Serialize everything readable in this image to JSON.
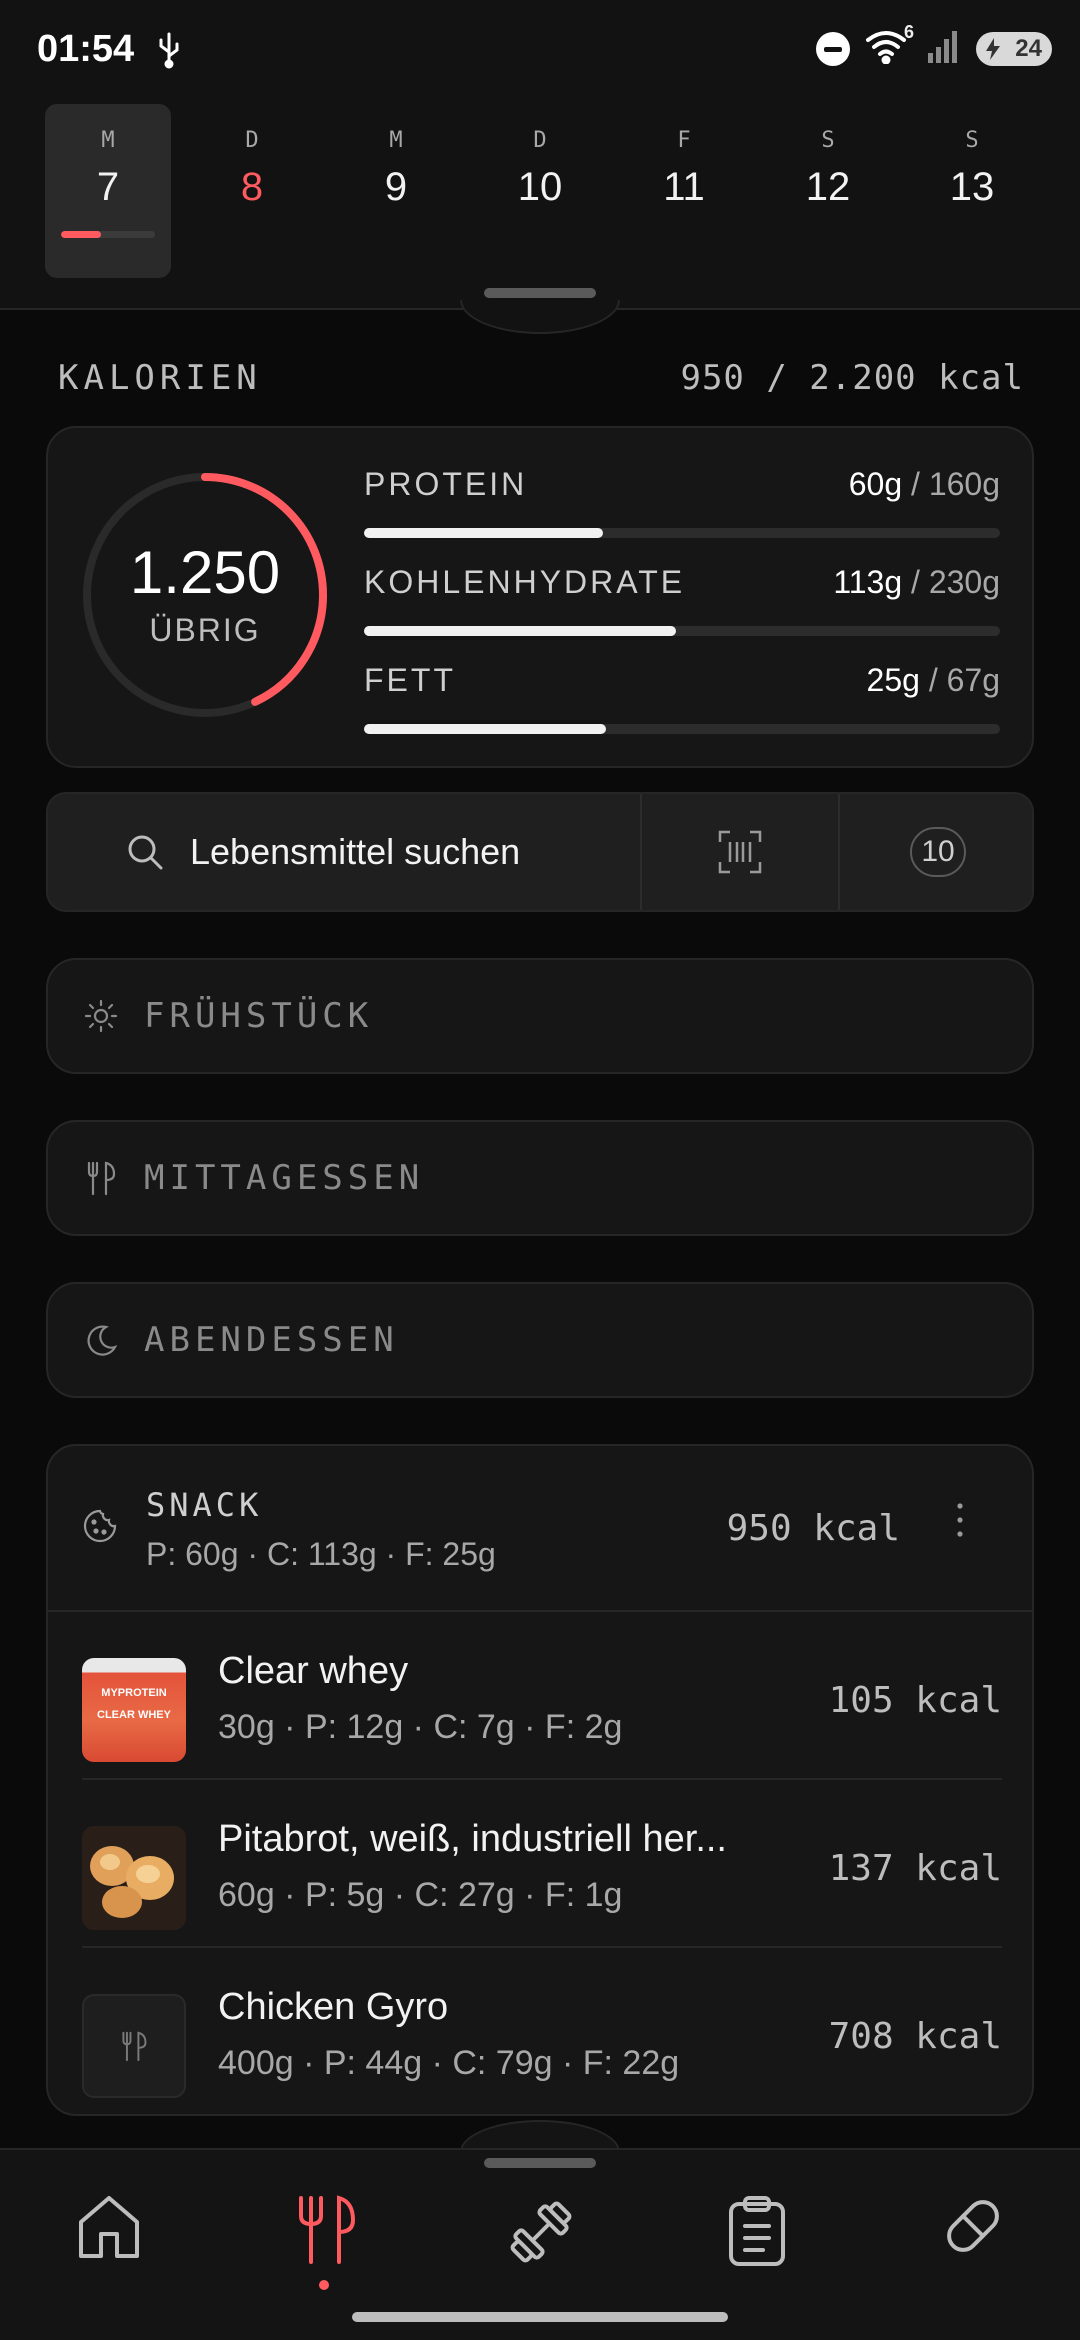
{
  "status_bar": {
    "time": "01:54",
    "wifi_badge": "6",
    "battery": "24",
    "icons": [
      "usb-icon",
      "do-not-disturb-icon",
      "wifi-icon",
      "signal-icon",
      "battery-charging-icon"
    ]
  },
  "week": {
    "days": [
      {
        "letter": "M",
        "num": "7",
        "active": true,
        "progress": 0.43
      },
      {
        "letter": "D",
        "num": "8",
        "today": true
      },
      {
        "letter": "M",
        "num": "9"
      },
      {
        "letter": "D",
        "num": "10"
      },
      {
        "letter": "F",
        "num": "11"
      },
      {
        "letter": "S",
        "num": "12"
      },
      {
        "letter": "S",
        "num": "13"
      }
    ]
  },
  "calories": {
    "label": "KALORIEN",
    "total": "950 / 2.200 kcal",
    "remaining": "1.250",
    "remaining_label": "ÜBRIG",
    "consumed_fraction": 0.43
  },
  "macros": [
    {
      "name": "PROTEIN",
      "value": "60g",
      "goal": "/ 160g",
      "fraction": 0.375
    },
    {
      "name": "KOHLENHYDRATE",
      "value": "113g",
      "goal": "/ 230g",
      "fraction": 0.49
    },
    {
      "name": "FETT",
      "value": "25g",
      "goal": "/ 67g",
      "fraction": 0.38
    }
  ],
  "search": {
    "label": "Lebensmittel suchen",
    "quick_count": "10"
  },
  "meals": {
    "breakfast": "FRÜHSTÜCK",
    "lunch": "MITTAGESSEN",
    "dinner": "ABENDESSEN"
  },
  "snack": {
    "title": "SNACK",
    "macros": "P: 60g · C: 113g · F: 25g",
    "kcal": "950 kcal",
    "items": [
      {
        "name": "Clear whey",
        "detail": "30g · P: 12g · C: 7g · F: 2g",
        "kcal": "105 kcal",
        "thumb_text": "MYPROTEIN CLEAR WHEY"
      },
      {
        "name": "Pitabrot, weiß, industriell her...",
        "detail": "60g · P: 5g · C: 27g · F: 1g",
        "kcal": "137 kcal"
      },
      {
        "name": "Chicken Gyro",
        "detail": "400g · P: 44g · C: 79g · F: 22g",
        "kcal": "708 kcal"
      }
    ]
  },
  "nav": {
    "items": [
      "home-icon",
      "nutrition-icon",
      "workout-icon",
      "clipboard-icon",
      "supplement-icon"
    ],
    "active": "nutrition-icon",
    "accent": "#ff5a5f"
  }
}
